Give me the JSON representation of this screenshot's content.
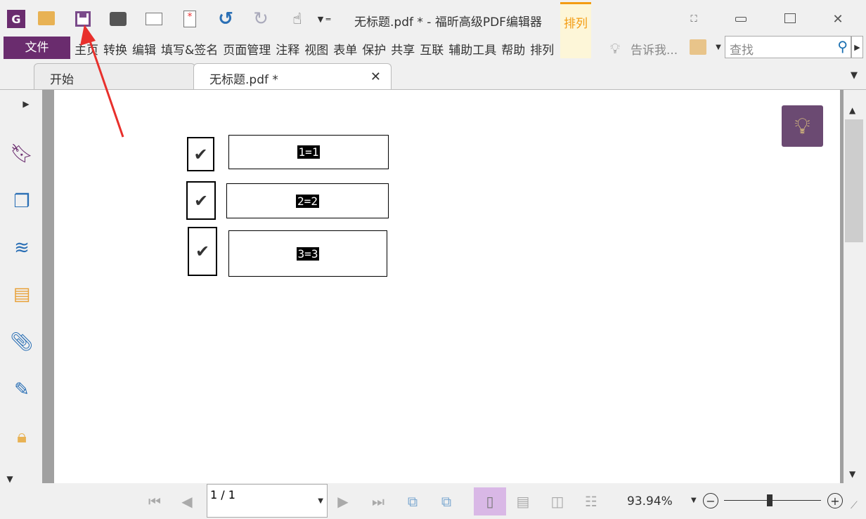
{
  "titlebar": {
    "file_name": "无标题.pdf *",
    "separator": "-",
    "app_name": "福昕高级PDF编辑器",
    "context_tab": "排列"
  },
  "menu": {
    "file": "文件",
    "items": [
      "主页",
      "转换",
      "编辑",
      "填写&签名",
      "页面管理",
      "注释",
      "视图",
      "表单",
      "保护",
      "共享",
      "互联",
      "辅助工具",
      "帮助",
      "排列"
    ],
    "tell_me": "告诉我...",
    "search_placeholder": "查找"
  },
  "tabs": [
    {
      "label": "开始"
    },
    {
      "label": "无标题.pdf *"
    }
  ],
  "document": {
    "fields": [
      {
        "value": "1=1",
        "checked": true
      },
      {
        "value": "2=2",
        "checked": true
      },
      {
        "value": "3=3",
        "checked": true
      }
    ],
    "check_glyph": "✔"
  },
  "statusbar": {
    "page": "1 / 1",
    "zoom": "93.94%",
    "zoom_slider_fraction": 0.47
  },
  "colors": {
    "brand": "#6a2c6e",
    "accent": "#f39c12",
    "arrow": "#e8302c"
  }
}
